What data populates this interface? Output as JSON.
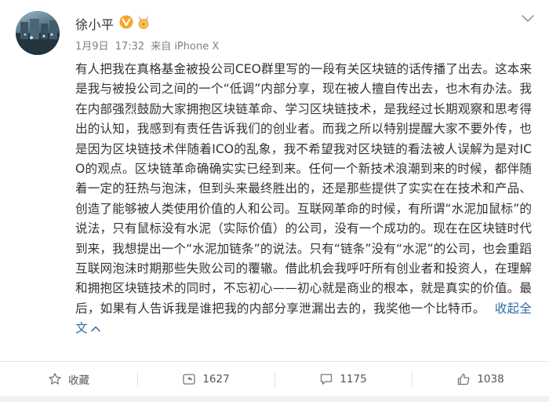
{
  "user": {
    "name": "徐小平",
    "verified_icon": "verified-v-icon",
    "medal_icon": "fan-medal-icon"
  },
  "post": {
    "date": "1月9日",
    "time": "17:32",
    "source_prefix": "来自",
    "source": "iPhone X",
    "paragraph": "有人把我在真格基金被投公司CEO群里写的一段有关区块链的话传播了出去。这本来是我与被投公司之间的一个“低调”内部分享，现在被人擅自传出去，也木有办法。我在内部强烈鼓励大家拥抱区块链革命、学习区块链技术，是我经过长期观察和思考得出的认知，我感到有责任告诉我们的创业者。而我之所以特别提醒大家不要外传，也是因为区块链技术伴随着ICO的乱象，我不希望我对区块链的看法被人误解为是对ICO的观点。区块链革命确确实实已经到来。任何一个新技术浪潮到来的时候，都伴随着一定的狂热与泡沫，但到头来最终胜出的，还是那些提供了实实在在技术和产品、创造了能够被人类使用价值的人和公司。互联网革命的时候，有所谓“水泥加鼠标”的说法，只有鼠标没有水泥（实际价值）的公司，没有一个成功的。现在在区块链时代到来，我想提出一个“水泥加链条”的说法。只有“链条”没有“水泥”的公司，也会重蹈互联网泡沫时期那些失败公司的覆辙。借此机会我呼吁所有创业者和投资人，在理解和拥抱区块链技术的同时，不忘初心——初心就是商业的根本，就是真实的价值。最后，如果有人告诉我是谁把我的内部分享泄漏出去的，我奖他一个比特币。",
    "collapse_label": "收起全文"
  },
  "actions": {
    "favorite_label": "收藏",
    "repost_count": "1627",
    "comment_count": "1175",
    "like_count": "1038"
  },
  "colors": {
    "link": "#2f69a6",
    "verified": "#f5a623",
    "text": "#333333",
    "meta": "#808080"
  }
}
